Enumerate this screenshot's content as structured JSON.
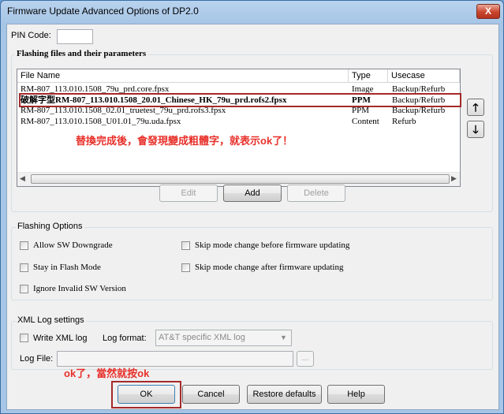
{
  "window": {
    "title": "Firmware Update Advanced Options of DP2.0",
    "close_glyph": "X"
  },
  "pin": {
    "label": "PIN Code:",
    "value": ""
  },
  "flashing_files": {
    "group_label": "Flashing files and their parameters",
    "columns": [
      "File Name",
      "Type",
      "Usecase"
    ],
    "rows": [
      {
        "file": "RM-807_113.010.1508_79u_prd.core.fpsx",
        "type": "Image",
        "usecase": "Backup/Refurb"
      },
      {
        "file": "破解字型RM-807_113.010.1508_20.01_Chinese_HK_79u_prd.rofs2.fpsx",
        "type": "PPM",
        "usecase": "Backup/Refurb"
      },
      {
        "file": "RM-807_113.010.1508_02.01_truetest_79u_prd.rofs3.fpsx",
        "type": "PPM",
        "usecase": "Backup/Refurb"
      },
      {
        "file": "RM-807_113.010.1508_U01.01_79u.uda.fpsx",
        "type": "Content",
        "usecase": "Refurb"
      }
    ],
    "annotation": "替換完成後，會發現變成粗體字，就表示ok了！",
    "edit_label": "Edit",
    "add_label": "Add",
    "delete_label": "Delete",
    "up_glyph": "🡑",
    "down_glyph": "🡓"
  },
  "flashing_options": {
    "group_label": "Flashing Options",
    "allow_downgrade": "Allow SW Downgrade",
    "stay_flash": "Stay in Flash Mode",
    "ignore_invalid": "Ignore Invalid SW Version",
    "skip_before": "Skip mode change before firmware updating",
    "skip_after": "Skip mode change after firmware updating"
  },
  "xml_log": {
    "group_label": "XML Log settings",
    "write_label": "Write XML log",
    "format_label": "Log format:",
    "format_value": "AT&T specific XML log",
    "file_label": "Log File:",
    "file_value": "",
    "browse_label": "..."
  },
  "bottom": {
    "annotation": "ok了，當然就按ok",
    "ok_label": "OK",
    "cancel_label": "Cancel",
    "restore_label": "Restore defaults",
    "help_label": "Help"
  },
  "colors": {
    "annotation": "#e8302a",
    "highlight_box": "#a52a2a"
  }
}
